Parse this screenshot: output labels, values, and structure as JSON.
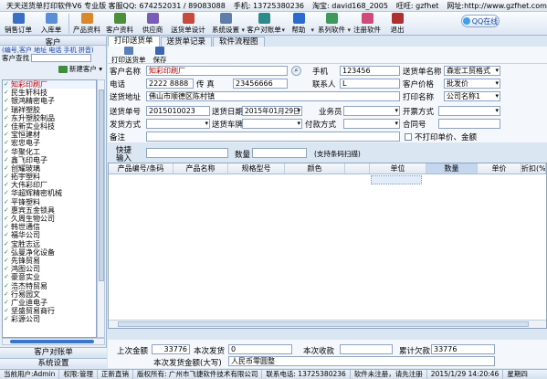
{
  "titlebar": {
    "title": "天天送货单打印软件V6 专业版 客服QQ: 674252031 / 89083088",
    "phone": "手机: 13725380236",
    "taobao": "淘宝: david168_2005",
    "wangwang": "旺旺: gzfhet",
    "website": "网址:http://www.gzfhet.com"
  },
  "toolbar": {
    "buttons": [
      {
        "label": "销售订单",
        "icon": "sales-order-icon",
        "color": "#3b6fc4"
      },
      {
        "label": "入库单",
        "icon": "stock-in-icon",
        "color": "#5a8fd8"
      },
      {
        "label": "产品资料",
        "icon": "product-icon",
        "color": "#d88a2b"
      },
      {
        "label": "客户资料",
        "icon": "customer-icon",
        "color": "#4a8f3a"
      },
      {
        "label": "供应商",
        "icon": "supplier-icon",
        "color": "#7a5bb5"
      },
      {
        "label": "送货单设计",
        "icon": "design-icon",
        "color": "#c84a3a"
      },
      {
        "label": "系统设置",
        "icon": "settings-icon",
        "color": "#5e7da8"
      },
      {
        "label": "客户对账单",
        "icon": "statement-icon",
        "color": "#2d8a8a"
      },
      {
        "label": "帮助",
        "icon": "help-icon",
        "color": "#2b6bd0"
      },
      {
        "label": "系列软件",
        "icon": "software-series-icon",
        "color": "#3e9a5a"
      },
      {
        "label": "注册软件",
        "icon": "register-icon",
        "color": "#d04a7a"
      },
      {
        "label": "退出",
        "icon": "exit-icon",
        "color": "#b03030"
      }
    ],
    "qq_online": "QQ在线"
  },
  "left_panel": {
    "header": "客户",
    "hint": "(编号,客户 地址 电话 手机 拼音)",
    "search_label": "客户查找",
    "search_value": "",
    "new_customer_label": "新建客户",
    "customers": [
      "知彩印刷厂",
      "民生轩科技",
      "银鸿精密电子",
      "瑞祥塑胶",
      "东升塑胶制品",
      "佳新实业科技",
      "宝恒建材",
      "宏忠电子",
      "华聚化工",
      "鑫飞印电子",
      "创耀玻璃",
      "拓宇塑料",
      "大伟彩印厂",
      "华超辉精密机械",
      "平锋塑料",
      "惠宾五金锁具",
      "久周生物公司",
      "韩世通信",
      "福华公司",
      "宝胜志远",
      "弘曼净化设备",
      "先锋贸易",
      "鸿图公司",
      "豪意实业",
      "浩杰特贸易",
      "行易园文",
      "广业迪电子",
      "坚盛贸易商行",
      "彩源公司"
    ],
    "selected_index": 0,
    "nav_statement": "客户对账单",
    "nav_settings": "系统设置"
  },
  "tabs": [
    "打印送货单",
    "送货单记录",
    "软件流程图"
  ],
  "actions": {
    "print": "打印送货单",
    "save": "保存"
  },
  "form": {
    "customer_name_label": "客户名称",
    "customer_name": "知彩印刷厂",
    "mobile_label": "手机",
    "mobile": "123456",
    "deliverer_name_label": "送货单名称",
    "deliverer_name": "森宏工贸格式",
    "phone_label": "电话",
    "phone": "2222 8888",
    "fax_label": "传 真",
    "fax": "23456666",
    "contact_label": "联系人",
    "contact": "L",
    "price_label": "客户价格",
    "price": "批发价",
    "address_label": "送货地址",
    "address": "佛山市顺德区陈村镇",
    "printer_label": "打印名称",
    "printer": "公司名称1",
    "order_no_label": "送货单号",
    "order_no": "2015010023",
    "date_label": "送货日期",
    "date": "2015年01月29日",
    "salesman_label": "业务员",
    "salesman": "",
    "invoice_label": "开票方式",
    "invoice": "",
    "ship_label": "发货方式",
    "ship": "",
    "car_label": "送货车牌",
    "car": "",
    "pay_label": "付款方式",
    "pay": "",
    "contract_label": "合同号",
    "contract": "",
    "remark_label": "备注",
    "remark": "",
    "no_price_label": "不打印单价、金额",
    "quick_label_1": "快捷",
    "quick_label_2": "输入",
    "quantity_label": "数量",
    "barcode_label": "(支持条码扫描)"
  },
  "grid": {
    "columns": [
      "产品编号/条码",
      "产品名称",
      "规格型号",
      "颜色",
      "单位",
      "数量",
      "单价",
      "折扣(%)"
    ],
    "highlight_index": 5,
    "rows": []
  },
  "totals": {
    "last_owed_label": "上次金额",
    "last_owed": "33776",
    "this_ship_label": "本次发货",
    "this_ship": "0",
    "this_recv_label": "本次收款",
    "this_recv": "",
    "total_owed_label": "累计欠款",
    "total_owed": "33776",
    "upper_label": "本次发货金额(大写)",
    "upper_value": "人民币零圆整"
  },
  "status": {
    "user": "当前用户:Admin",
    "perm": "权限:管理",
    "data": "正新直销",
    "copyright": "版权所有: 广州市飞捷软件技术有限公司",
    "tel": "联系电话: 13725380236",
    "reg": "软件未注册，请先注册",
    "datetime": "2015/1/29  14:20:46",
    "weekday": "星期四"
  }
}
